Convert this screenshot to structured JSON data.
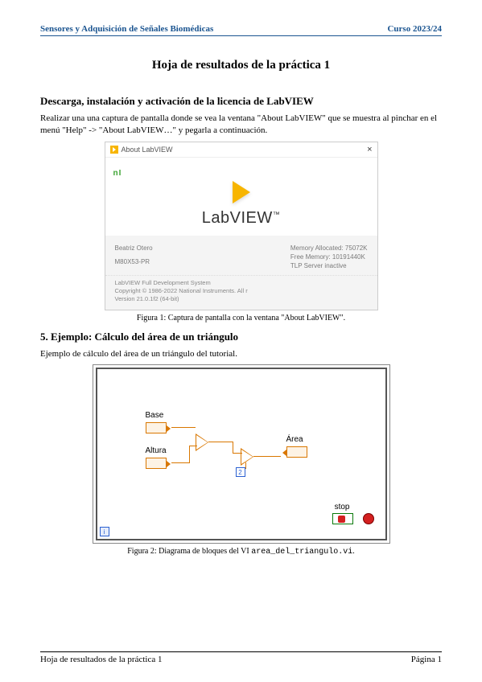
{
  "header": {
    "left": "Sensores y Adquisición de Señales Biomédicas",
    "right": "Curso 2023/24"
  },
  "title": "Hoja de resultados de la práctica 1",
  "section1": {
    "heading": "Descarga, instalación y activación de la licencia de LabVIEW",
    "body": "Realizar una una captura de pantalla donde se vea la ventana \"About LabVIEW\" que se muestra al pinchar en el menú \"Help\" -> \"About LabVIEW…\" y pegarla a continuación."
  },
  "about": {
    "titlebar": "About LabVIEW",
    "ni": "nI",
    "product": "LabVIEW",
    "tm": "™",
    "user": "Beatriz Otero",
    "machine": "M80X53-PR",
    "mem1": "Memory Allocated: 75072K",
    "mem2": "Free Memory: 10191440K",
    "mem3": "TLP Server inactive",
    "line1": "LabVIEW Full Development System",
    "line2": "Copyright © 1986-2022 National Instruments. All r",
    "line3": "Version 21.0.1f2 (64-bit)"
  },
  "caption1": "Figura 1: Captura de pantalla con la ventana \"About LabVIEW\".",
  "section2": {
    "heading": "5. Ejemplo: Cálculo del área de un triángulo",
    "body": "Ejemplo de cálculo del área de un triángulo del tutorial."
  },
  "bd": {
    "base": "Base",
    "altura": "Altura",
    "area": "Área",
    "stop": "stop",
    "two": "2",
    "iter": "i"
  },
  "caption2_a": "Figura 2: Diagrama de bloques del VI ",
  "caption2_b": "area_del_triangulo.vi",
  "caption2_c": ".",
  "footer": {
    "left": "Hoja de resultados de la práctica 1",
    "right": "Página 1"
  }
}
